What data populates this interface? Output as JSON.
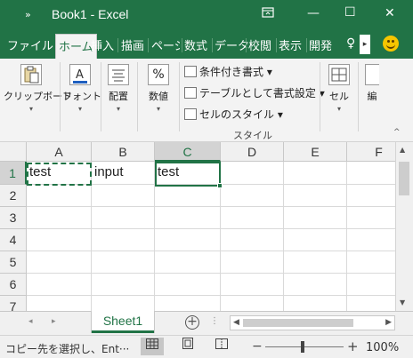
{
  "window": {
    "qat_glyph": "»",
    "title": "Book1  -  Excel",
    "ribbon_display_icon": "ribbon-display-options-icon",
    "minimize_glyph": "—",
    "maximize_glyph": "☐",
    "close_glyph": "✕"
  },
  "tabs": [
    {
      "label": "ファイル"
    },
    {
      "label": "ホーム",
      "selected": true
    },
    {
      "label": "挿入"
    },
    {
      "label": "描画"
    },
    {
      "label": "ページ"
    },
    {
      "label": "数式"
    },
    {
      "label": "データ"
    },
    {
      "label": "校閲"
    },
    {
      "label": "表示"
    },
    {
      "label": "開発"
    }
  ],
  "tab_scroll_glyph": "▸",
  "tell_me_glyph": "♀",
  "ribbon": {
    "clipboard": {
      "label": "クリップボード",
      "arrow": "▾"
    },
    "font": {
      "label": "フォント",
      "arrow": "▾"
    },
    "alignment": {
      "label": "配置",
      "arrow": "▾"
    },
    "number": {
      "label": "数値",
      "icon_text": "%",
      "arrow": "▾"
    },
    "conditional_format": "条件付き書式 ▾",
    "format_as_table": "テーブルとして書式設定 ▾",
    "cell_styles": "セルのスタイル ▾",
    "styles_group_label": "スタイル",
    "cells": {
      "label": "セル",
      "arrow": "▾"
    },
    "editing_partial": "編"
  },
  "columns": [
    "A",
    "B",
    "C",
    "D",
    "E",
    "F"
  ],
  "rows": [
    "1",
    "2",
    "3",
    "4",
    "5",
    "6",
    "7"
  ],
  "cells": {
    "A1": "test",
    "B1": "input",
    "C1": "test"
  },
  "active_cell": "C1",
  "copy_range": "A1",
  "sheet_tabs": [
    "Sheet1"
  ],
  "sheetbar": {
    "prev_glyph": "◂",
    "next_glyph": "▸",
    "add_glyph": "+",
    "dots": "⋮"
  },
  "status": {
    "message": "コピー先を選択し、Ent···",
    "zoom_minus": "−",
    "zoom_plus": "+",
    "zoom_level": "100%",
    "zoom_percent": 100
  },
  "colors": {
    "accent": "#217346",
    "chrome": "#217346"
  }
}
